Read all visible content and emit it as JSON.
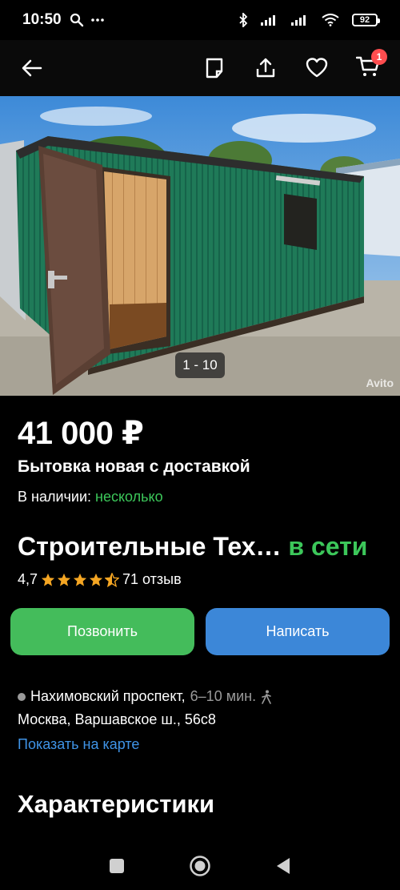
{
  "status_bar": {
    "time": "10:50",
    "battery": "92"
  },
  "nav": {
    "cart_count": "1",
    "icons": [
      "back-arrow-icon",
      "note-icon",
      "share-icon",
      "heart-icon",
      "cart-icon"
    ]
  },
  "gallery": {
    "counter": "1 - 10",
    "watermark": "Avito"
  },
  "listing": {
    "price": "41 000 ₽",
    "title": "Бытовка новая с доставкой",
    "availability_label": "В наличии: ",
    "availability_value": "несколько"
  },
  "seller": {
    "name": "Строительные Тех…",
    "online": "в сети",
    "rating": "4,7",
    "stars": 4.5,
    "reviews": "71 отзыв"
  },
  "actions": {
    "call": "Позвонить",
    "write": "Написать"
  },
  "location": {
    "metro": "Нахимовский проспект,",
    "metro_time": "6–10 мин.",
    "address": "Москва, Варшавское ш., 56с8",
    "map_link": "Показать на карте"
  },
  "section": {
    "title": "Характеристики"
  },
  "colors": {
    "green": "#44bc5b",
    "blue": "#3c87d8",
    "link": "#3f93e6",
    "star": "#f5a623"
  }
}
